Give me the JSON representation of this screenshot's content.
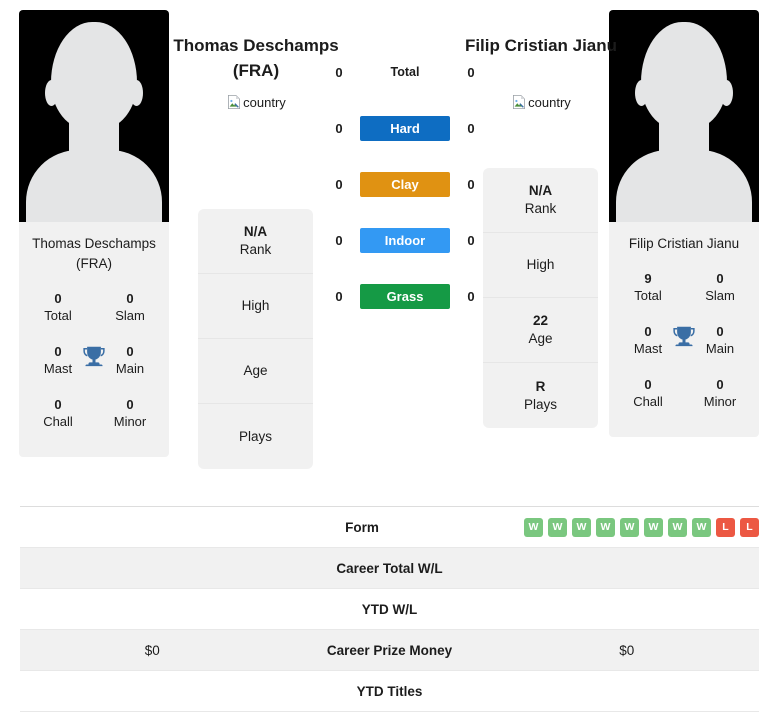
{
  "players": {
    "left": {
      "header_name": "Thomas Deschamps (FRA)",
      "card_name": "Thomas Deschamps (FRA)",
      "country_alt": "country",
      "trophies": {
        "total_value": "0",
        "total_label": "Total",
        "slam_value": "0",
        "slam_label": "Slam",
        "mast_value": "0",
        "mast_label": "Mast",
        "main_value": "0",
        "main_label": "Main",
        "chall_value": "0",
        "chall_label": "Chall",
        "minor_value": "0",
        "minor_label": "Minor"
      },
      "info": [
        {
          "value": "N/A",
          "label": "Rank"
        },
        {
          "value": "",
          "label": "High"
        },
        {
          "value": "",
          "label": "Age"
        },
        {
          "value": "",
          "label": "Plays"
        }
      ],
      "surface_values": {
        "total": "0",
        "hard": "0",
        "clay": "0",
        "indoor": "0",
        "grass": "0"
      },
      "career_total_wl": "",
      "ytd_wl": "",
      "career_prize_money": "$0",
      "ytd_titles": ""
    },
    "right": {
      "header_name": "Filip Cristian Jianu",
      "card_name": "Filip Cristian Jianu",
      "country_alt": "country",
      "trophies": {
        "total_value": "9",
        "total_label": "Total",
        "slam_value": "0",
        "slam_label": "Slam",
        "mast_value": "0",
        "mast_label": "Mast",
        "main_value": "0",
        "main_label": "Main",
        "chall_value": "0",
        "chall_label": "Chall",
        "minor_value": "0",
        "minor_label": "Minor"
      },
      "info": [
        {
          "value": "N/A",
          "label": "Rank"
        },
        {
          "value": "",
          "label": "High"
        },
        {
          "value": "22",
          "label": "Age"
        },
        {
          "value": "R",
          "label": "Plays"
        }
      ],
      "surface_values": {
        "total": "0",
        "hard": "0",
        "clay": "0",
        "indoor": "0",
        "grass": "0"
      },
      "career_total_wl": "",
      "ytd_wl": "",
      "career_prize_money": "$0",
      "ytd_titles": ""
    }
  },
  "surfaces": [
    {
      "key": "total",
      "label": "Total",
      "color": "transparent"
    },
    {
      "key": "hard",
      "label": "Hard",
      "color": "#0e6dc2"
    },
    {
      "key": "clay",
      "label": "Clay",
      "color": "#e09212"
    },
    {
      "key": "indoor",
      "label": "Indoor",
      "color": "#3399f3"
    },
    {
      "key": "grass",
      "label": "Grass",
      "color": "#159a45"
    }
  ],
  "table": {
    "form_label": "Form",
    "career_total_wl_label": "Career Total W/L",
    "ytd_wl_label": "YTD W/L",
    "career_prize_money_label": "Career Prize Money",
    "ytd_titles_label": "YTD Titles"
  },
  "form": {
    "left_results": [],
    "right_results": [
      "W",
      "W",
      "W",
      "W",
      "W",
      "W",
      "W",
      "W",
      "L",
      "L"
    ],
    "win_color": "#7ac77f",
    "loss_color": "#ec5843",
    "win_letter": "W",
    "loss_letter": "L"
  },
  "colors": {
    "card_bg": "#f1f1f1",
    "trophy": "#3a6ea5",
    "photo_bg": "#000000"
  }
}
